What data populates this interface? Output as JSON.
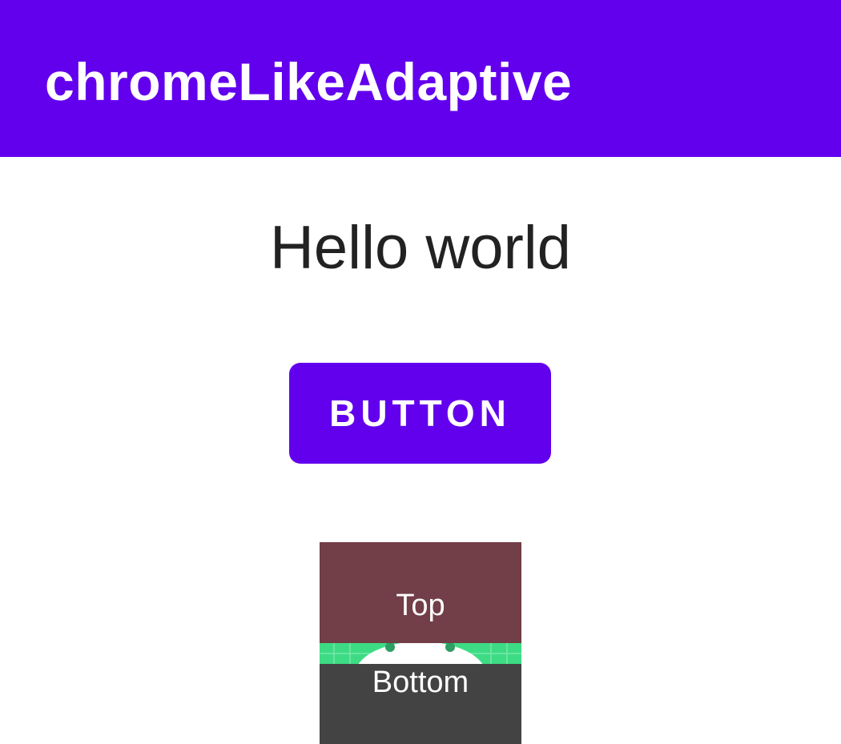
{
  "app_bar": {
    "title": "chromeLikeAdaptive",
    "color": "#6200EE"
  },
  "main": {
    "hello_text": "Hello world",
    "button_label": "BUTTON",
    "button_color": "#6200EE",
    "composite": {
      "top_label": "Top",
      "top_color": "#723E47",
      "background_image": "android-robot-icon",
      "bottom_label": "Bottom",
      "bottom_color": "#434343"
    }
  }
}
